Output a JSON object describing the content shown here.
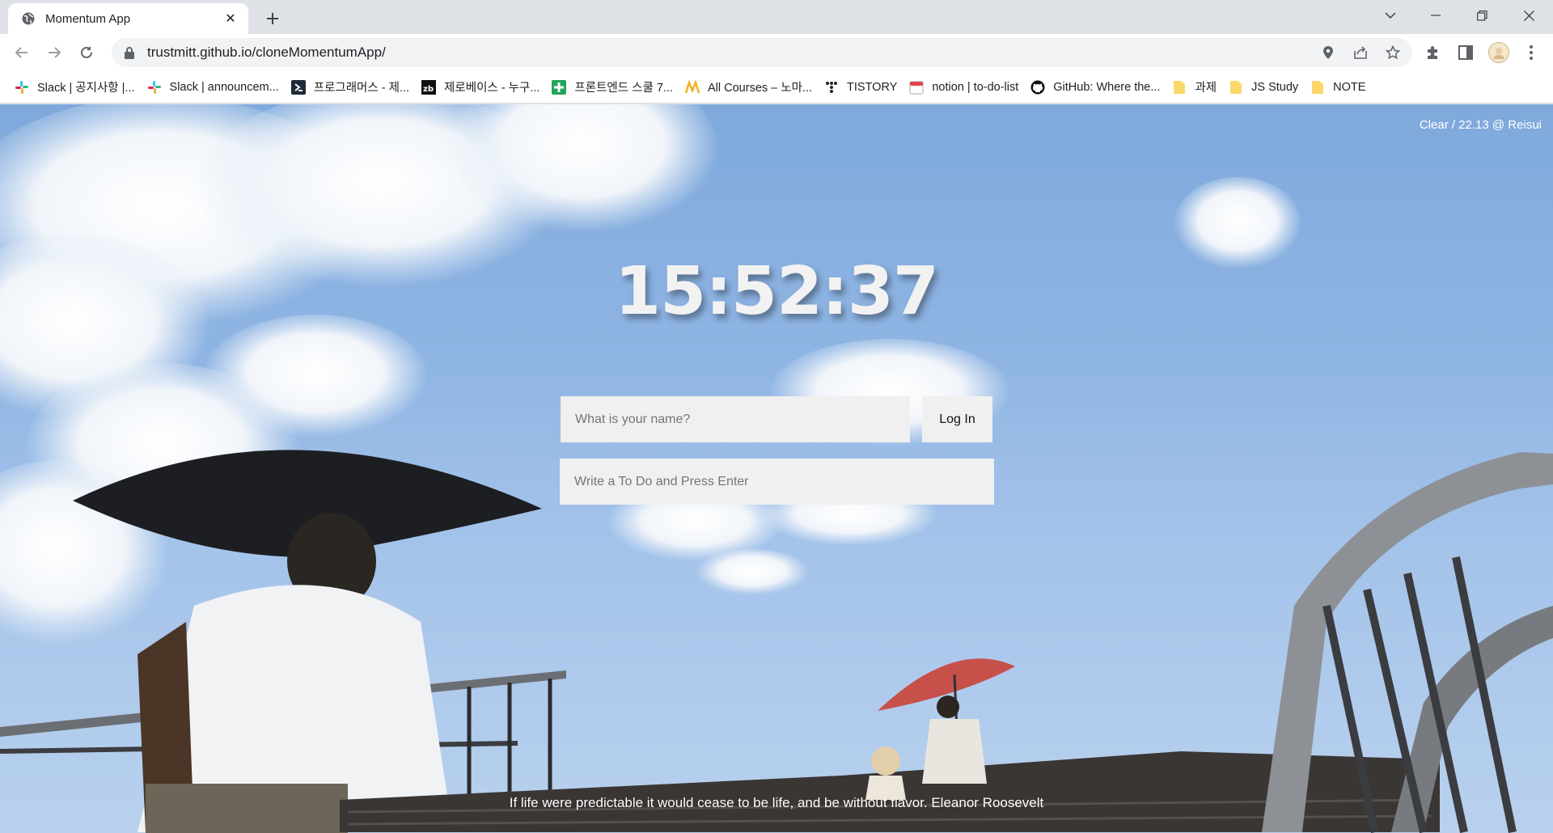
{
  "browser": {
    "tab_title": "Momentum App",
    "url": "trustmitt.github.io/cloneMomentumApp/"
  },
  "bookmarks": [
    {
      "label": "Slack | 공지사항 |...",
      "icon": "slack-icon"
    },
    {
      "label": "Slack | announcem...",
      "icon": "slack-icon"
    },
    {
      "label": "프로그래머스 - 제...",
      "icon": "programmers-icon"
    },
    {
      "label": "제로베이스 - 누구...",
      "icon": "zerobase-icon"
    },
    {
      "label": "프론트엔드 스쿨 7...",
      "icon": "plus-green-icon"
    },
    {
      "label": "All Courses – 노마...",
      "icon": "nomad-icon"
    },
    {
      "label": "TISTORY",
      "icon": "tistory-icon"
    },
    {
      "label": "notion | to-do-list",
      "icon": "calendar-icon"
    },
    {
      "label": "GitHub: Where the...",
      "icon": "github-icon"
    },
    {
      "label": "과제",
      "icon": "folder-icon"
    },
    {
      "label": "JS Study",
      "icon": "folder-icon"
    },
    {
      "label": "NOTE",
      "icon": "folder-icon"
    }
  ],
  "page": {
    "weather": "Clear / 22.13 @ Reisui",
    "clock": "15:52:37",
    "login_placeholder": "What is your name?",
    "login_button": "Log In",
    "todo_placeholder": "Write a To Do and Press Enter",
    "quote": "If life were predictable it would cease to be life, and be without flavor. Eleanor Roosevelt"
  },
  "colors": {
    "sky": "#8fb5e3",
    "input_bg": "#f0f0f0",
    "tabstrip": "#dee1e6"
  }
}
